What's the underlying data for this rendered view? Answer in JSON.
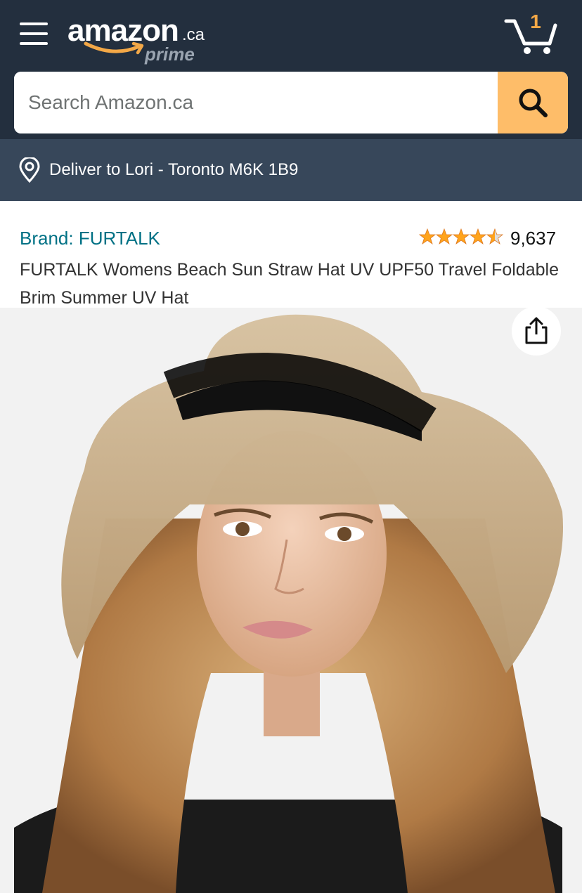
{
  "header": {
    "logo_word": "amazon",
    "logo_tld": ".ca",
    "logo_sub": "prime",
    "cart_count": "1",
    "icons": {
      "menu": "hamburger-menu-icon",
      "cart": "cart-icon",
      "search": "search-icon",
      "location": "location-pin-icon",
      "share": "share-icon"
    },
    "colors": {
      "header_bg": "#232f3e",
      "deliver_bg": "#37475a",
      "search_button": "#febd69",
      "accent_orange": "#f3a847",
      "brand_link": "#007185"
    }
  },
  "search": {
    "placeholder": "Search Amazon.ca"
  },
  "delivery": {
    "label": "Deliver to Lori - Toronto M6K 1B9"
  },
  "product": {
    "brand": "Brand: FURTALK",
    "rating_stars": 4.5,
    "rating_count": "9,637",
    "title": "FURTALK Womens Beach Sun Straw Hat UV UPF50 Travel Foldable Brim Summer UV Hat",
    "image_subject": "woman-wearing-straw-sun-hat"
  }
}
